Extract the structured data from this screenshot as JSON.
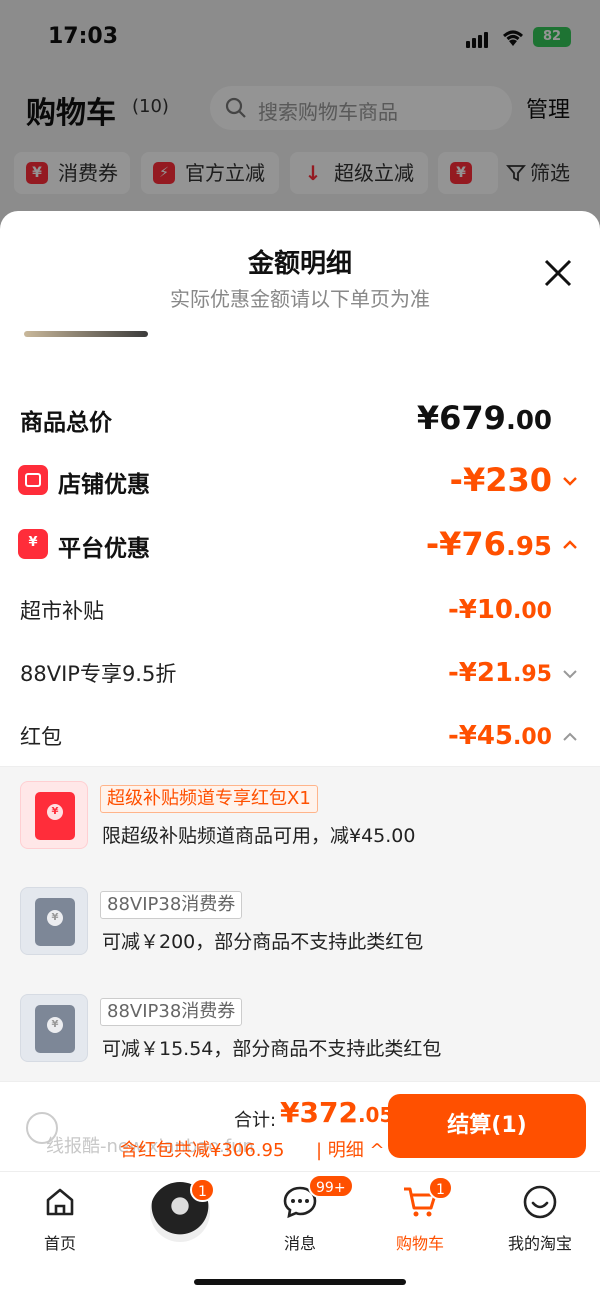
{
  "status": {
    "time": "17:03",
    "battery": "82"
  },
  "header": {
    "title": "购物车",
    "count": "(10)",
    "search_placeholder": "搜索购物车商品",
    "manage": "管理"
  },
  "chips": [
    {
      "label": "消费券",
      "icon": "¥"
    },
    {
      "label": "官方立减",
      "icon": "⚡"
    },
    {
      "label": "超级立减",
      "icon": "↓"
    },
    {
      "label": "",
      "icon": "¥"
    }
  ],
  "filter": "筛选",
  "sheet": {
    "title": "金额明细",
    "subtitle": "实际优惠金额请以下单页为准",
    "rows": {
      "total": {
        "label": "商品总价",
        "amount_int": "¥679",
        "amount_dec": ".00"
      },
      "shop": {
        "label": "店铺优惠",
        "amount_int": "-¥230",
        "amount_dec": ""
      },
      "platform": {
        "label": "平台优惠",
        "amount_int": "-¥76",
        "amount_dec": ".95"
      },
      "supermarket": {
        "label": "超市补贴",
        "amount_int": "-¥10",
        "amount_dec": ".00"
      },
      "vip": {
        "label": "88VIP专享9.5折",
        "amount_int": "-¥21",
        "amount_dec": ".95"
      },
      "redpacket": {
        "label": "红包",
        "amount_int": "-¥45",
        "amount_dec": ".00"
      }
    },
    "packets": [
      {
        "tag": "超级补贴频道专享红包X1",
        "desc": "限超级补贴频道商品可用，减¥45.00",
        "style": "red"
      },
      {
        "tag": "88VIP38消费券",
        "desc": "可减￥200，部分商品不支持此类红包",
        "style": "gray"
      },
      {
        "tag": "88VIP38消费券",
        "desc": "可减￥15.54，部分商品不支持此类红包",
        "style": "gray"
      }
    ]
  },
  "bottom": {
    "total_label": "合计:",
    "total_int": "¥372",
    "total_dec": ".05",
    "saved": "含红包共减¥306.95",
    "detail": "| 明细 ^",
    "checkout": "结算(1)",
    "watermark": "线报酷-new.xianbao.fun"
  },
  "tabs": [
    {
      "label": "首页",
      "icon": "home-icon"
    },
    {
      "label": "",
      "icon": "avatar",
      "badge": "1"
    },
    {
      "label": "消息",
      "icon": "message-icon",
      "badge": "99+"
    },
    {
      "label": "购物车",
      "icon": "cart-icon",
      "badge": "1",
      "active": true
    },
    {
      "label": "我的淘宝",
      "icon": "profile-icon"
    }
  ],
  "colors": {
    "accent": "#ff5000",
    "red": "#ff2d3a"
  }
}
